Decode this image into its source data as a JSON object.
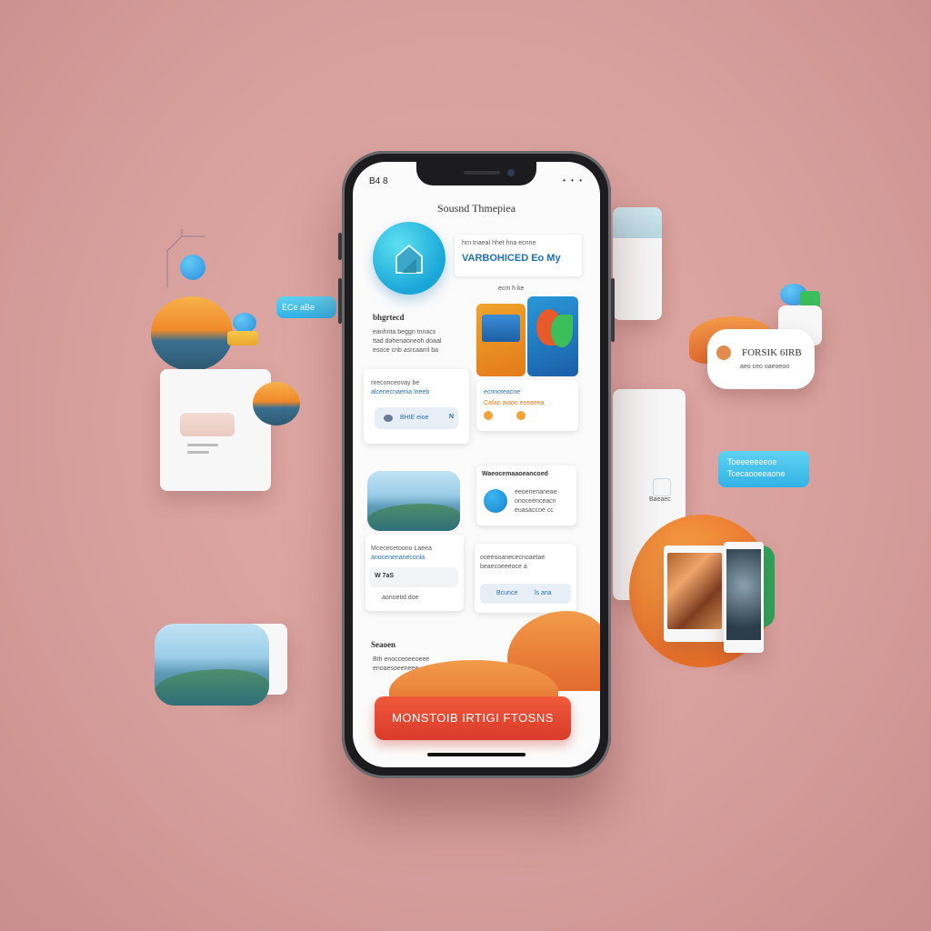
{
  "status": {
    "time": "B4 8",
    "icons": "• • •"
  },
  "app": {
    "title": "Sousnd Thmepiea",
    "promo": {
      "sub": "hrn tnaeal hhet hna ecnne",
      "main": "VARBOHICED Eo My"
    },
    "tag_top": "ecm h ke",
    "section1": {
      "head": "bhgrtecd",
      "lines": [
        "eanhnta  beggn tnnacs",
        "ttad dahenaoneoh doaal",
        "esoce cnb asrcaaml ba"
      ]
    },
    "card1": {
      "line": "nreconceovay be",
      "sub": "alcenecnaenia lneeb",
      "button": "BHIE  eioe",
      "mark": "N"
    },
    "card2": {
      "line": "ecnnoteacne",
      "sub": "Cafao aiaoo ezeaeea"
    },
    "card3": {
      "head": "Waeocemaaoeancoed",
      "lines": [
        "eeoenenaneae",
        "onoceenceacn",
        "euasaccoe cc"
      ]
    },
    "card4": {
      "line": "Mcececetoono Laeea",
      "sub": "anocenenaneconla",
      "value": "W 7aS",
      "footer": "aonoetid doe"
    },
    "card5": {
      "line": "ooeeooanececnoaetae",
      "sub": "beaecoeeeoce a",
      "b1": "Bcunce",
      "b2": "ls ana"
    },
    "section2": {
      "head": "Seaoen",
      "lines": [
        "Bth enocceoeeoeee",
        "enoaesoeeneee"
      ]
    },
    "cta": "MONSTOIB IRTIGI FTOSNS"
  },
  "floating": {
    "left_chip": "ECe aBe",
    "right_bubble": "FORSIK 6IRB",
    "right_bubble_sub": "aeo ceo oaeoeoo",
    "right_pill_1": "Toeeeeeeeoe",
    "right_pill_2": "Tcecaooeeaone",
    "right_card_label": "Baeaec"
  }
}
